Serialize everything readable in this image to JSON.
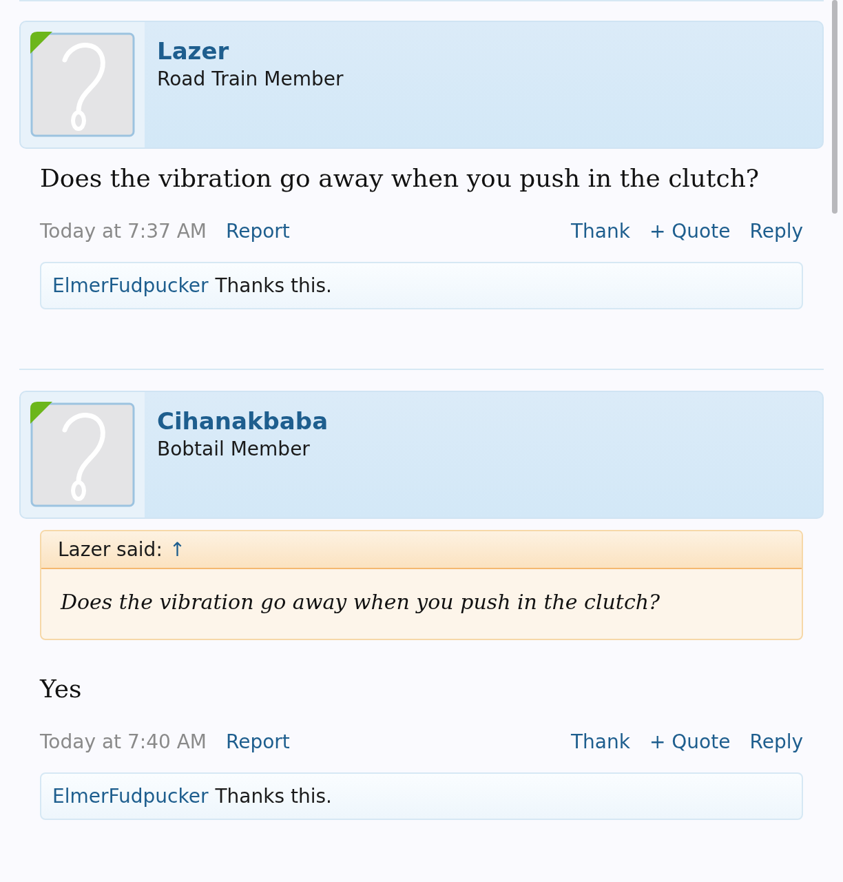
{
  "posts": [
    {
      "user": "Lazer",
      "role": "Road Train Member",
      "online": true,
      "body": "Does the vibration go away when you push in the clutch?",
      "time": "Today at 7:37 AM",
      "report": "Report",
      "actions": [
        "Thank",
        "+ Quote",
        "Reply"
      ],
      "likes": {
        "user": "ElmerFudpucker",
        "text": "Thanks this."
      }
    },
    {
      "user": "Cihanakbaba",
      "role": "Bobtail Member",
      "online": true,
      "quote": {
        "author": "Lazer said:",
        "arrow": "↑",
        "text": "Does the vibration go away when you push in the clutch?"
      },
      "body": "Yes",
      "time": "Today at 7:40 AM",
      "report": "Report",
      "actions": [
        "Thank",
        "+ Quote",
        "Reply"
      ],
      "likes": {
        "user": "ElmerFudpucker",
        "text": "Thanks this."
      }
    }
  ]
}
